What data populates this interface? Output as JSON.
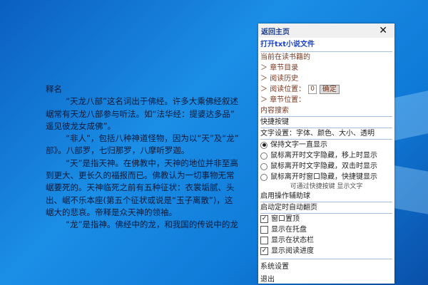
{
  "reader": {
    "lines": [
      "释名",
      "“天龙八部”这名词出于佛经。许多大乘佛经叙述",
      "崌常有天龙八部参与听法。如“法华经：提婆达多品”",
      "遥见彼龙女成佛”。",
      "“非人”，包括八种神道怪物，因为以“天”及“龙”",
      "部》。八部罗，七归那罗，八摩听罗迦。",
      "“天”是指天神。在佛教中，天神的地位并非至高",
      "到更大、更长久的福报而已。佛教认为一切事物无常",
      "崌要死的。天神临死之前有五种征状：衣裳垢腻、头",
      "出、崌不乐本座(第五个征状或说是“玉子离散”)，这",
      "崌大的悲哀。帝释是众天神的领袖。",
      "“龙”是指神。佛经中的龙，和我国的传说中的龙"
    ]
  },
  "menu": {
    "title": "返回主页",
    "close": "✕",
    "open_file": "打开txt小说文件",
    "current_book": "当前在读书籍的",
    "chapters": "＞ 章节目录",
    "history": "＞ 阅读历史",
    "position": "＞ 阅读位置：",
    "position_value": "0",
    "confirm": "确定",
    "chapter_pos": "＞ 章节位置：",
    "search": "内容搜索",
    "hotkeys": "快捷按键",
    "text_settings": "文字设置：字体、颜色、大小、透明",
    "radios": [
      "保持文字一直显示",
      "鼠标离开时文字隐藏，移上时显示",
      "鼠标离开时文字隐藏，双击时显示",
      "鼠标离开时窗口隐藏，快捷键显示"
    ],
    "radio_note": "可通过快捷按键 显示文字",
    "assist_ball": "启用操作辅助球",
    "auto_page": "启动定时自动翻页",
    "checks": [
      "窗口置顶",
      "显示在托盘",
      "显示在状态栏",
      "显示阅读进度"
    ],
    "check_mark": "✓",
    "system": "系统设置",
    "exit": "退出"
  }
}
